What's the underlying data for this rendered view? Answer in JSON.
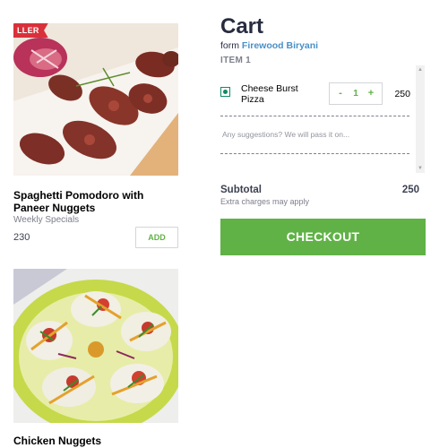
{
  "menu": {
    "items": [
      {
        "badge": "LLER",
        "name": "Spaghetti Pomodoro with Paneer Nuggets",
        "category": "Weekly Specials",
        "price": "230",
        "add_label": "ADD"
      },
      {
        "name": "Chicken Nuggets"
      }
    ]
  },
  "cart": {
    "title": "Cart",
    "from_prefix": "form",
    "restaurant": "Firewood Biryani",
    "item_count": "ITEM 1",
    "lines": [
      {
        "name": "Cheese Burst Pizza",
        "minus": "-",
        "quantity": "1",
        "plus": "+",
        "price": "250"
      }
    ],
    "suggestion_placeholder": "Any suggestions? We will pass it on...",
    "subtotal_label": "Subtotal",
    "subtotal_note": "Extra charges may apply",
    "subtotal_value": "250",
    "checkout_label": "CHECKOUT"
  },
  "colors": {
    "accent_green": "#60b246",
    "restaurant_link": "#4a90c8",
    "badge_red": "#d9303a",
    "veg_green": "#0f8a65"
  }
}
